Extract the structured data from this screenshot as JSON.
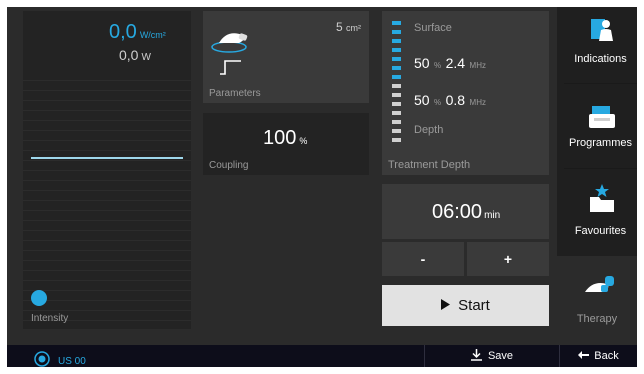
{
  "intensity": {
    "power_density_value": "0,0",
    "power_density_unit": "W/cm²",
    "power_value": "0,0",
    "power_unit": "W",
    "label": "Intensity"
  },
  "parameters": {
    "area_value": "5",
    "area_unit": "cm²",
    "label": "Parameters"
  },
  "coupling": {
    "value": "100",
    "unit": "%",
    "label": "Coupling"
  },
  "treatment_depth": {
    "surface_label": "Surface",
    "depth_label": "Depth",
    "row1_percent": "50",
    "row1_percent_unit": "%",
    "row1_freq": "2.4",
    "row1_freq_unit": "MHz",
    "row2_percent": "50",
    "row2_percent_unit": "%",
    "row2_freq": "0.8",
    "row2_freq_unit": "MHz",
    "label": "Treatment Depth"
  },
  "timer": {
    "value": "06:00",
    "unit": "min",
    "minus_label": "-",
    "plus_label": "+"
  },
  "start_button": {
    "label": "Start"
  },
  "sidebar": {
    "items": [
      {
        "label": "Indications",
        "icon": "indications-icon"
      },
      {
        "label": "Programmes",
        "icon": "programmes-icon"
      },
      {
        "label": "Favourites",
        "icon": "favourites-icon"
      },
      {
        "label": "Therapy",
        "icon": "therapy-icon"
      }
    ]
  },
  "footer": {
    "device_label": "US 00",
    "save_label": "Save",
    "back_label": "Back"
  },
  "colors": {
    "accent": "#27a9e1",
    "panel": "#3a3a3a",
    "background": "#2b2b2b"
  }
}
